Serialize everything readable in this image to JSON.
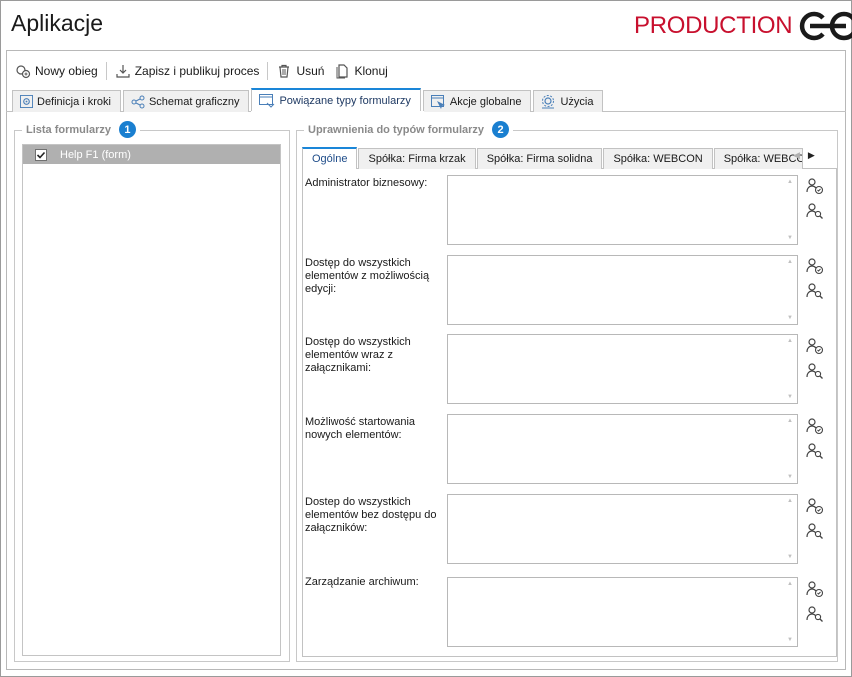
{
  "app": {
    "title": "Aplikacje",
    "brand": "PRODUCTION",
    "accent": "#c8102e",
    "tab_accent": "#1a86d8",
    "badge_color": "#1a7fd0"
  },
  "toolbar": {
    "new": {
      "label": "Nowy obieg",
      "icon": "new-workflow-icon"
    },
    "save": {
      "label": "Zapisz i publikuj proces",
      "icon": "save-publish-icon"
    },
    "delete": {
      "label": "Usuń",
      "icon": "trash-icon"
    },
    "clone": {
      "label": "Klonuj",
      "icon": "copy-icon"
    }
  },
  "tabs": [
    {
      "label": "Definicja i kroki",
      "icon": "gear-icon"
    },
    {
      "label": "Schemat graficzny",
      "icon": "diagram-icon"
    },
    {
      "label": "Powiązane typy formularzy",
      "icon": "form-types-icon",
      "active": true
    },
    {
      "label": "Akcje globalne",
      "icon": "actions-icon"
    },
    {
      "label": "Użycia",
      "icon": "usage-icon"
    }
  ],
  "forms_group": {
    "legend": "Lista formularzy",
    "badge": "1",
    "items": [
      {
        "label": "Help F1 (form)",
        "checked": true,
        "selected": true
      }
    ]
  },
  "permissions_group": {
    "legend": "Uprawnienia do typów formularzy",
    "badge": "2",
    "tabs": [
      {
        "label": "Ogólne",
        "active": true
      },
      {
        "label": "Spółka: Firma krzak"
      },
      {
        "label": "Spółka: Firma solidna"
      },
      {
        "label": "Spółka: WEBCON"
      },
      {
        "label": "Spółka: WEBCON"
      }
    ],
    "rows": [
      {
        "label": "Administrator biznesowy:"
      },
      {
        "label": "Dostęp do wszystkich elementów z możliwością edycji:"
      },
      {
        "label": "Dostęp do wszystkich elementów wraz z załącznikami:"
      },
      {
        "label": "Możliwość startowania nowych elementów:"
      },
      {
        "label": "Dostep do wszystkich elementów bez dostępu do załączników:"
      },
      {
        "label": "Zarządzanie archiwum:"
      }
    ]
  }
}
